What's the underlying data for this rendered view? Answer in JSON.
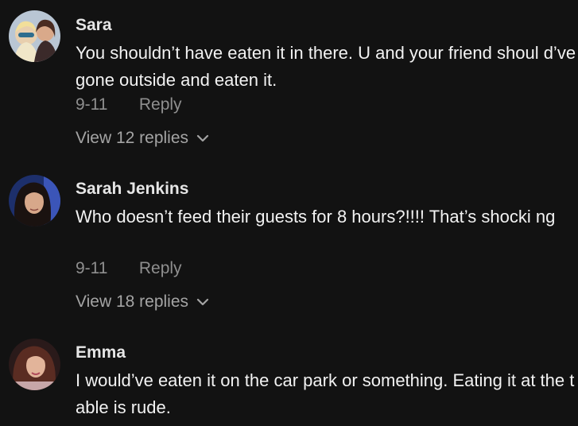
{
  "comments": [
    {
      "author": "Sara",
      "text": "You shouldn’t have eaten it in there. U and your friend shoul d’ve gone outside and eaten it.",
      "date": "9-11",
      "reply_label": "Reply",
      "view_replies": "View 12 replies",
      "chevron_icon": "chevron-down-icon"
    },
    {
      "author": "Sarah Jenkins",
      "text": "Who doesn’t feed their guests for 8 hours?!!!! That’s shocki ng",
      "date": "9-11",
      "reply_label": "Reply",
      "view_replies": "View 18 replies",
      "chevron_icon": "chevron-down-icon"
    },
    {
      "author": "Emma",
      "text": "I would’ve eaten it on the car park or something. Eating it at the table is rude."
    }
  ],
  "colors": {
    "background": "#121212",
    "author": "#e6e6e6",
    "text": "#f2f2f2",
    "meta": "#8f8f8f"
  }
}
